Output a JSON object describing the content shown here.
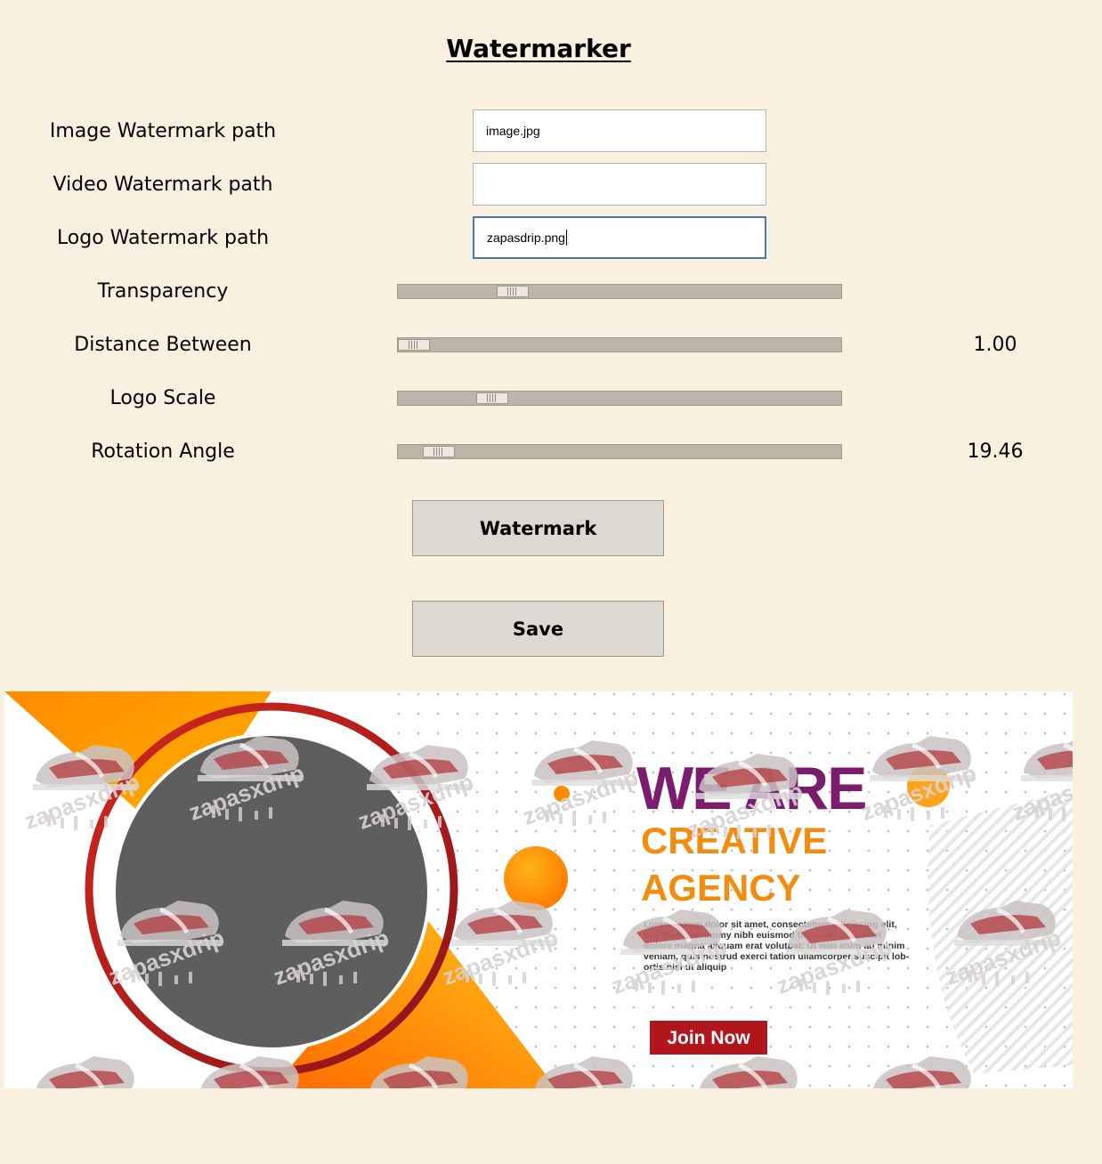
{
  "app": {
    "title": "Watermarker"
  },
  "fields": {
    "image_path": {
      "label": "Image Watermark path",
      "value": "image.jpg"
    },
    "video_path": {
      "label": "Video Watermark path",
      "value": ""
    },
    "logo_path": {
      "label": "Logo Watermark path",
      "value": "zapasdrip.png"
    }
  },
  "sliders": {
    "transparency": {
      "label": "Transparency",
      "position": 0.24,
      "value_text": ""
    },
    "distance": {
      "label": "Distance Between",
      "position": 0.0,
      "value_text": "1.00"
    },
    "logo_scale": {
      "label": "Logo Scale",
      "position": 0.19,
      "value_text": ""
    },
    "rotation": {
      "label": "Rotation Angle",
      "position": 0.06,
      "value_text": "19.46"
    }
  },
  "buttons": {
    "watermark": "Watermark",
    "save": "Save"
  },
  "preview": {
    "headline": "WE ARE",
    "line2": "CREATIVE",
    "line3": "AGENCY",
    "body": [
      "Lorem ipsum dolor sit amet, consectetuer adipiscing elit,",
      "sed diam nonummy nibh euismod tincidunt ut laoreet",
      "dolore magna aliquam erat volutpat. Ut wisi enim ad minim",
      "veniam, quis nostrud exerci tation ullamcorper suscipit lob-",
      "ortis nisl ut aliquip"
    ],
    "cta": "Join Now",
    "watermark_text": "zapasxdrip",
    "colors": {
      "purple": "#7b1c6e",
      "orange": "#f28c0f",
      "dark_red": "#b0161b",
      "circle_gray": "#5e5e5e"
    }
  }
}
